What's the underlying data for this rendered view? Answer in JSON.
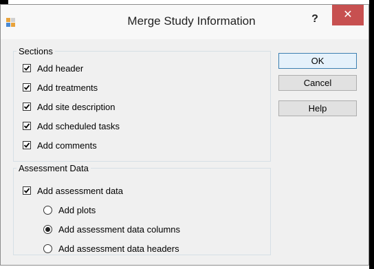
{
  "window": {
    "title": "Merge Study Information",
    "help_glyph": "?",
    "close_glyph": "✕"
  },
  "sections": {
    "legend": "Sections",
    "items": [
      {
        "label": "Add header",
        "checked": true
      },
      {
        "label": "Add treatments",
        "checked": true
      },
      {
        "label": "Add site description",
        "checked": true
      },
      {
        "label": "Add scheduled tasks",
        "checked": true
      },
      {
        "label": "Add comments",
        "checked": true
      }
    ]
  },
  "assessment": {
    "legend": "Assessment Data",
    "checkbox_label": "Add assessment data",
    "checkbox_checked": true,
    "radios": [
      {
        "label": "Add plots",
        "selected": false
      },
      {
        "label": "Add assessment data columns",
        "selected": true
      },
      {
        "label": "Add assessment data headers",
        "selected": false
      }
    ]
  },
  "buttons": {
    "ok": "OK",
    "cancel": "Cancel",
    "help": "Help"
  },
  "colors": {
    "close_red": "#c75050",
    "dialog_bg": "#f0f0f0",
    "default_button_border": "#3c7fb1"
  }
}
